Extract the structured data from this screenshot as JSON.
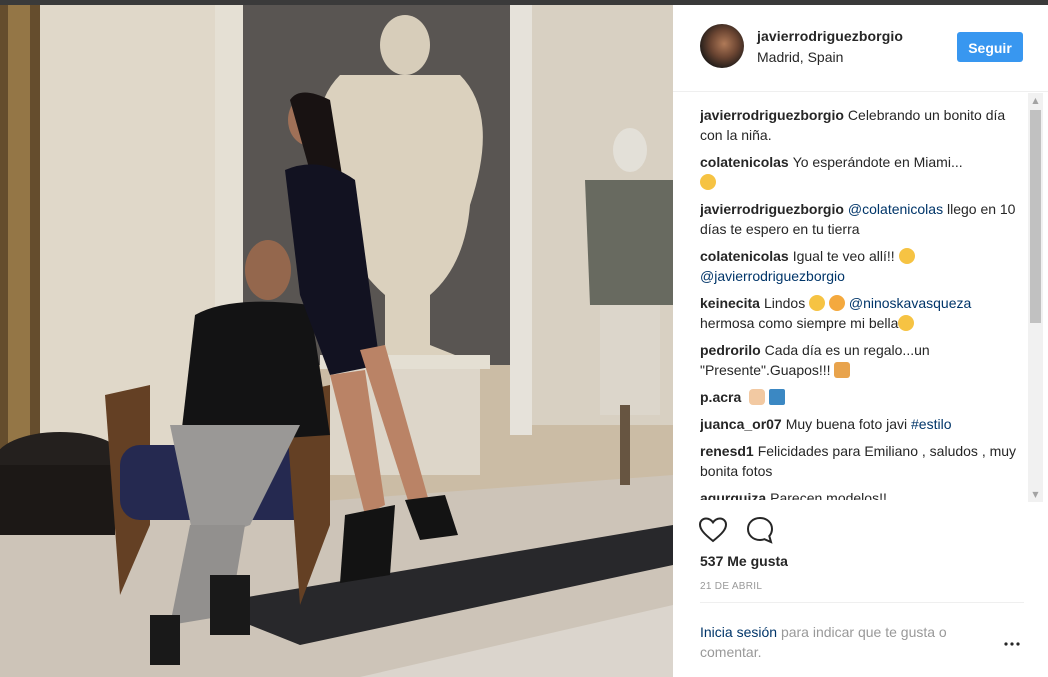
{
  "post": {
    "username": "javierrodriguezborgio",
    "location": "Madrid, Spain",
    "follow_label": "Seguir",
    "likes": "537 Me gusta",
    "date": "21 DE ABRIL"
  },
  "comments": [
    {
      "user": "javierrodriguezborgio",
      "text": "Celebrando un bonito día con la niña."
    },
    {
      "user": "colatenicolas",
      "text": "Yo esperándote en Miami..."
    },
    {
      "user": "javierrodriguezborgio",
      "mention": "@colatenicolas",
      "text": "llego en 10 días te espero en tu tierra"
    },
    {
      "user": "colatenicolas",
      "text": "Igual te veo allí!!",
      "mention": "@javierrodriguezborgio"
    },
    {
      "user": "keinecita",
      "text": "Lindos",
      "mention": "@ninoskavasqueza",
      "text2": "hermosa como siempre mi bella"
    },
    {
      "user": "pedrorilo",
      "text": "Cada día es un regalo...un \"Presente\".Guapos!!!"
    },
    {
      "user": "p.acra",
      "text": ""
    },
    {
      "user": "juanca_or07",
      "text": "Muy buena foto javi",
      "mention": "#estilo"
    },
    {
      "user": "renesd1",
      "text": "Felicidades para Emiliano , saludos , muy bonita fotos"
    },
    {
      "user": "agurquiza",
      "text": "Parecen modelos!!"
    }
  ],
  "login": {
    "link": "Inicia sesión",
    "text": "para indicar que te gusta o comentar."
  },
  "icons": [
    "heart-icon",
    "comment-icon",
    "more-options-icon"
  ],
  "colors": {
    "accent": "#3897f0",
    "link": "#003569",
    "muted": "#999999"
  }
}
